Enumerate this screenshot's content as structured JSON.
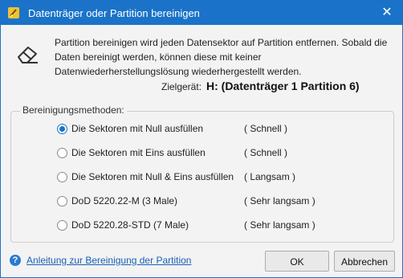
{
  "window": {
    "title": "Datenträger oder Partition bereinigen",
    "close_glyph": "✕"
  },
  "icons": {
    "app": "app-broom-icon",
    "main": "eraser-icon",
    "help": "help-icon"
  },
  "description": "Partition bereinigen wird jeden Datensektor auf Partition entfernen. Sobald die Daten bereinigt werden, können diese mit keiner Datenwiederherstellungslösung wiederhergestellt werden.",
  "target": {
    "label": "Zielgerät:",
    "value": "H: (Datenträger 1 Partition 6)"
  },
  "methods": {
    "legend": "Bereinigungsmethoden:",
    "options": [
      {
        "label": "Die Sektoren mit Null ausfüllen",
        "speed": "( Schnell )",
        "selected": true
      },
      {
        "label": "Die Sektoren mit Eins ausfüllen",
        "speed": "( Schnell )",
        "selected": false
      },
      {
        "label": "Die Sektoren mit Null & Eins ausfüllen",
        "speed": "( Langsam )",
        "selected": false
      },
      {
        "label": "DoD 5220.22-M (3 Male)",
        "speed": "( Sehr langsam )",
        "selected": false
      },
      {
        "label": "DoD 5220.28-STD (7 Male)",
        "speed": "( Sehr langsam )",
        "selected": false
      }
    ]
  },
  "footer": {
    "help_glyph": "?",
    "help_link": "Anleitung zur Bereinigung der Partition",
    "ok_label": "OK",
    "cancel_label": "Abbrechen"
  },
  "colors": {
    "titlebar": "#1a73c8",
    "accent": "#1a73c8",
    "link": "#1a5fb4"
  }
}
